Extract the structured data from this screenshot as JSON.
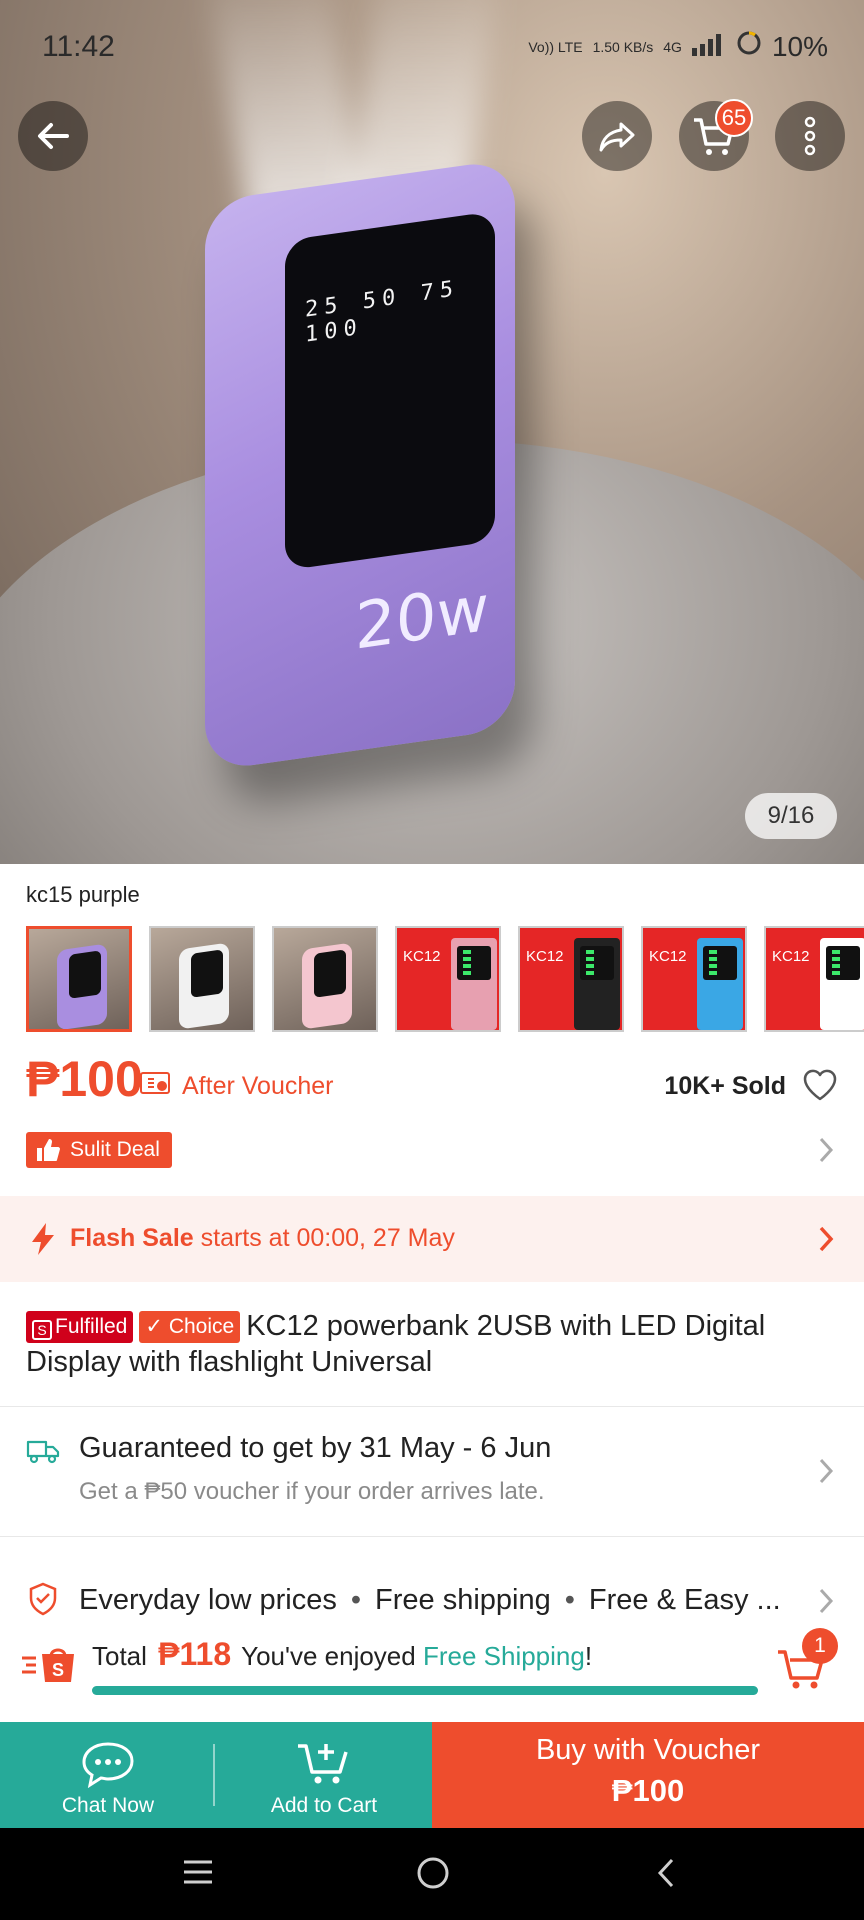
{
  "status_bar": {
    "time": "11:42",
    "network_top": "Vo)) LTE",
    "speed": "1.50 KB/s",
    "network_type": "4G",
    "battery": "10%"
  },
  "header": {
    "cart_count": "65",
    "icons": [
      "back-arrow-icon",
      "share-icon",
      "cart-icon",
      "more-vertical-icon"
    ]
  },
  "gallery": {
    "counter": "9/16",
    "image_text": {
      "levels": "25 50 75 100",
      "watt": "20w"
    }
  },
  "variant": {
    "name": "kc15 purple",
    "thumbnails": [
      {
        "kind": "photo",
        "color": "#a98ee0",
        "selected": true
      },
      {
        "kind": "photo",
        "color": "#f1f1f1",
        "selected": false
      },
      {
        "kind": "photo",
        "color": "#f4c6cf",
        "selected": false
      },
      {
        "kind": "box",
        "brand": "KC12",
        "color": "#e7a0b0",
        "selected": false
      },
      {
        "kind": "box",
        "brand": "KC12",
        "color": "#222222",
        "selected": false
      },
      {
        "kind": "box",
        "brand": "KC12",
        "color": "#3aa7e5",
        "selected": false
      },
      {
        "kind": "box",
        "brand": "KC12",
        "color": "#ffffff",
        "selected": false
      }
    ]
  },
  "price": {
    "amount": "₱100",
    "after_voucher": "After Voucher",
    "sold": "10K+ Sold"
  },
  "deal": {
    "label": "Sulit Deal"
  },
  "flash_sale": {
    "label": "Flash Sale",
    "text": " starts at 00:00, 27 May"
  },
  "product": {
    "tag_fulfilled": "Fulfilled",
    "tag_choice": "Choice",
    "title": "KC12 powerbank 2USB with LED Digital Display with flashlight Universal"
  },
  "shipping": {
    "title": "Guaranteed to get by 31 May - 6 Jun",
    "subtitle": "Get a ₱50 voucher if your order arrives late."
  },
  "perks": {
    "p1": "Everyday low prices",
    "p2": "Free shipping",
    "p3": "Free & Easy ..."
  },
  "cart_summary": {
    "total_label": "Total",
    "total_amount": "₱118",
    "message_prefix": "You've enjoyed ",
    "message_highlight": "Free Shipping",
    "message_suffix": "!",
    "progress": 1.0,
    "cart_badge": "1"
  },
  "actions": {
    "chat": "Chat Now",
    "add_to_cart": "Add to Cart",
    "buy_line1": "Buy with Voucher",
    "buy_line2": "₱100"
  },
  "colors": {
    "brand": "#ee4d2d",
    "teal": "#26aa99"
  }
}
